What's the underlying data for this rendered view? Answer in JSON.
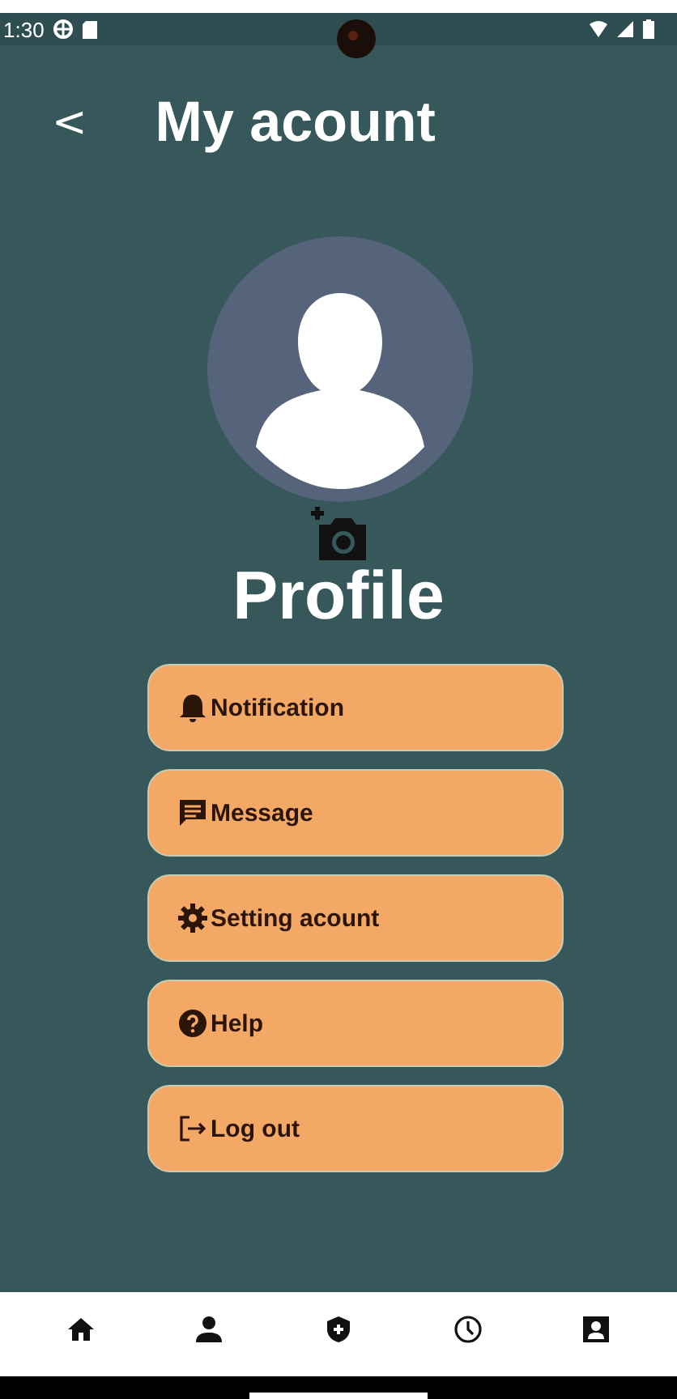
{
  "status_bar": {
    "time": "1:30"
  },
  "header": {
    "back": "<",
    "title": "My acount"
  },
  "profile": {
    "name": "Profile"
  },
  "menu": [
    {
      "kind": "notification",
      "label": "Notification"
    },
    {
      "kind": "message",
      "label": "Message"
    },
    {
      "kind": "settings",
      "label": "Setting acount"
    },
    {
      "kind": "help",
      "label": "Help"
    },
    {
      "kind": "logout",
      "label": "Log out"
    }
  ],
  "nav": [
    {
      "kind": "home"
    },
    {
      "kind": "person"
    },
    {
      "kind": "shield"
    },
    {
      "kind": "clock"
    },
    {
      "kind": "contact"
    }
  ]
}
